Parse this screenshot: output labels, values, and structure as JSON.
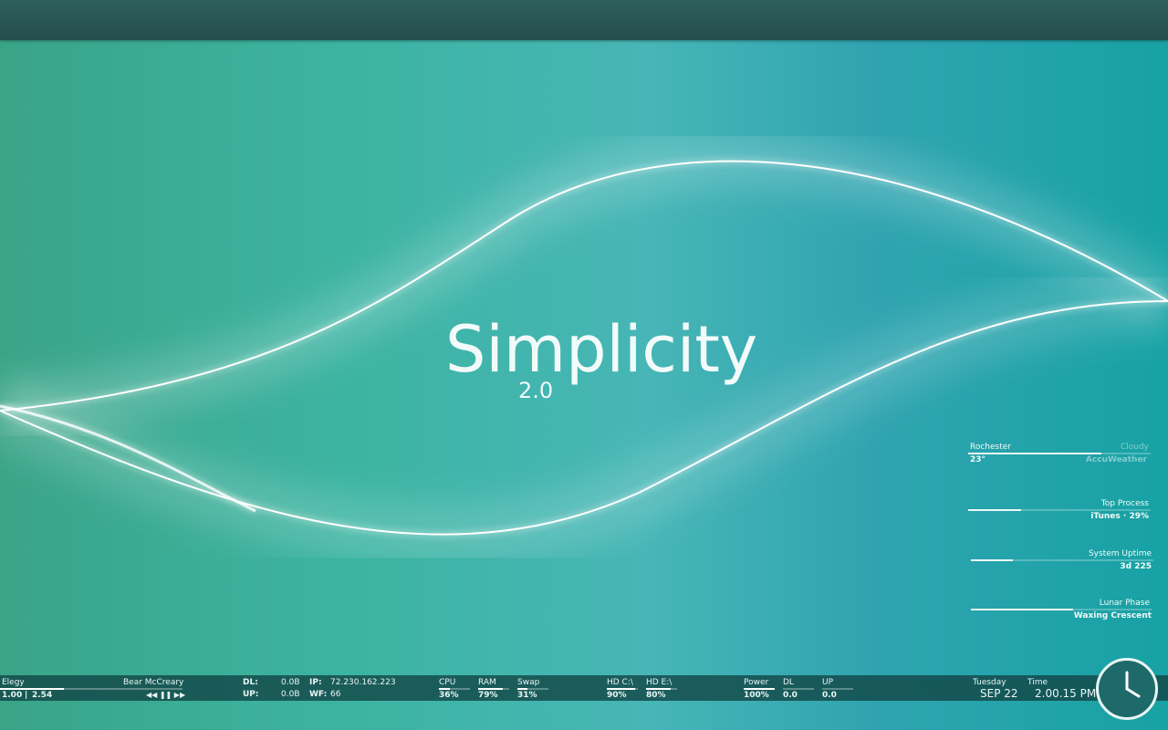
{
  "logo": {
    "title": "Simplicity",
    "version": "2.0"
  },
  "weather": {
    "city": "Rochester",
    "condition": "Cloudy",
    "temp": "23°",
    "source": "AccuWeather"
  },
  "top_process": {
    "label": "Top Process",
    "value": "iTunes · 29%",
    "level": 0.29
  },
  "uptime": {
    "label": "System Uptime",
    "value": "3d 225"
  },
  "lunar": {
    "label": "Lunar Phase",
    "value": "Waxing Crescent"
  },
  "music": {
    "track": "Elegy",
    "artist": "Bear McCreary",
    "position": "1.00",
    "length": "2.54",
    "controls": "◀◀ ❚❚ ▶▶"
  },
  "network": {
    "dl_label": "DL:",
    "dl_value": "0.0B",
    "up_label": "UP:",
    "up_value": "0.0B",
    "ip_label": "IP:",
    "ip_value": "72.230.162.223",
    "wf_label": "WF:",
    "wf_value": "66"
  },
  "system": {
    "cpu_label": "CPU",
    "cpu_value": "36%",
    "ram_label": "RAM",
    "ram_value": "79%",
    "swap_label": "Swap",
    "swap_value": "31%"
  },
  "disks": {
    "c_label": "HD C:\\",
    "c_value": "90%",
    "e_label": "HD E:\\",
    "e_value": "80%"
  },
  "power": {
    "power_label": "Power",
    "power_value": "100%",
    "dl_label": "DL",
    "dl_value": "0.0",
    "up_label": "UP",
    "up_value": "0.0"
  },
  "datetime": {
    "day": "Tuesday",
    "date": "SEP 22",
    "time_label": "Time",
    "time": "2.00.15 PM"
  }
}
